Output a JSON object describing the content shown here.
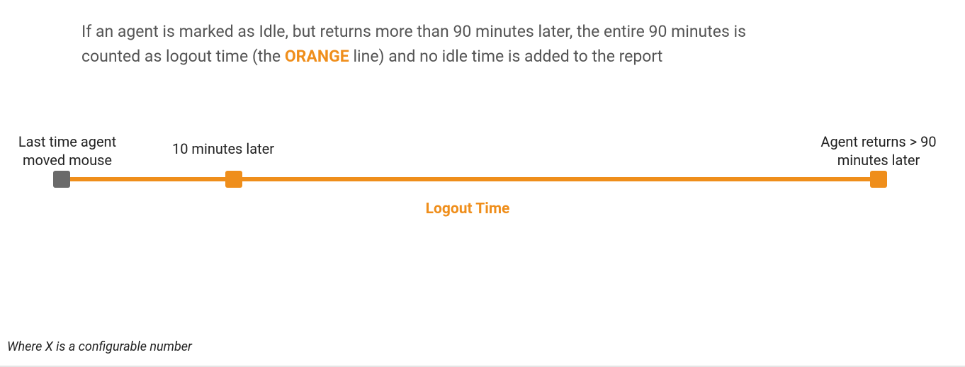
{
  "description": {
    "text_before": "If an agent is marked as Idle, but returns more than 90 minutes later, the entire 90 minutes is counted as logout time (the ",
    "highlight": "ORANGE",
    "text_after": " line) and no idle time is added to the report"
  },
  "chart_data": {
    "type": "timeline",
    "points": [
      {
        "id": "start",
        "label": "Last time agent moved mouse",
        "offset_minutes": 0,
        "color": "#6a6a6a"
      },
      {
        "id": "idle",
        "label": "10 minutes later",
        "offset_minutes": 10,
        "color": "#ef8e1b"
      },
      {
        "id": "end",
        "label": "Agent returns > 90 minutes later",
        "offset_minutes": 90,
        "color": "#ef8e1b"
      }
    ],
    "segments": [
      {
        "from": "start",
        "to": "end",
        "label": "Logout Time",
        "color": "#ef8e1b"
      }
    ]
  },
  "colors": {
    "orange": "#ef8e1b",
    "gray_marker": "#6a6a6a",
    "body_text": "#555555"
  },
  "footnote": "Where X is a configurable number"
}
